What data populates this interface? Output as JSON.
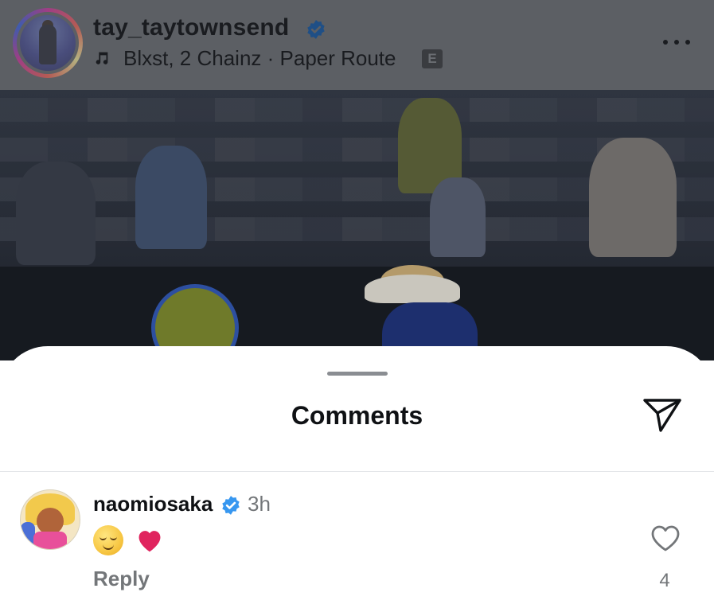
{
  "post_header": {
    "username": "tay_taytownsend",
    "audio": "Blxst, 2 Chainz · Paper Route",
    "explicit_badge": "E",
    "icons": [
      "verified-icon",
      "music-note-icon",
      "more-icon"
    ]
  },
  "comments_sheet": {
    "title": "Comments",
    "icons": [
      "share-icon"
    ]
  },
  "comments": [
    {
      "username": "naomiosaka",
      "time": "3h",
      "text": "😌❤️",
      "reply_label": "Reply",
      "like_count": "4"
    }
  ],
  "colors": {
    "verified": "#3797f0",
    "heart": "#e0245e",
    "muted_text": "#737679",
    "dim_overlay": "#5c5f64"
  }
}
